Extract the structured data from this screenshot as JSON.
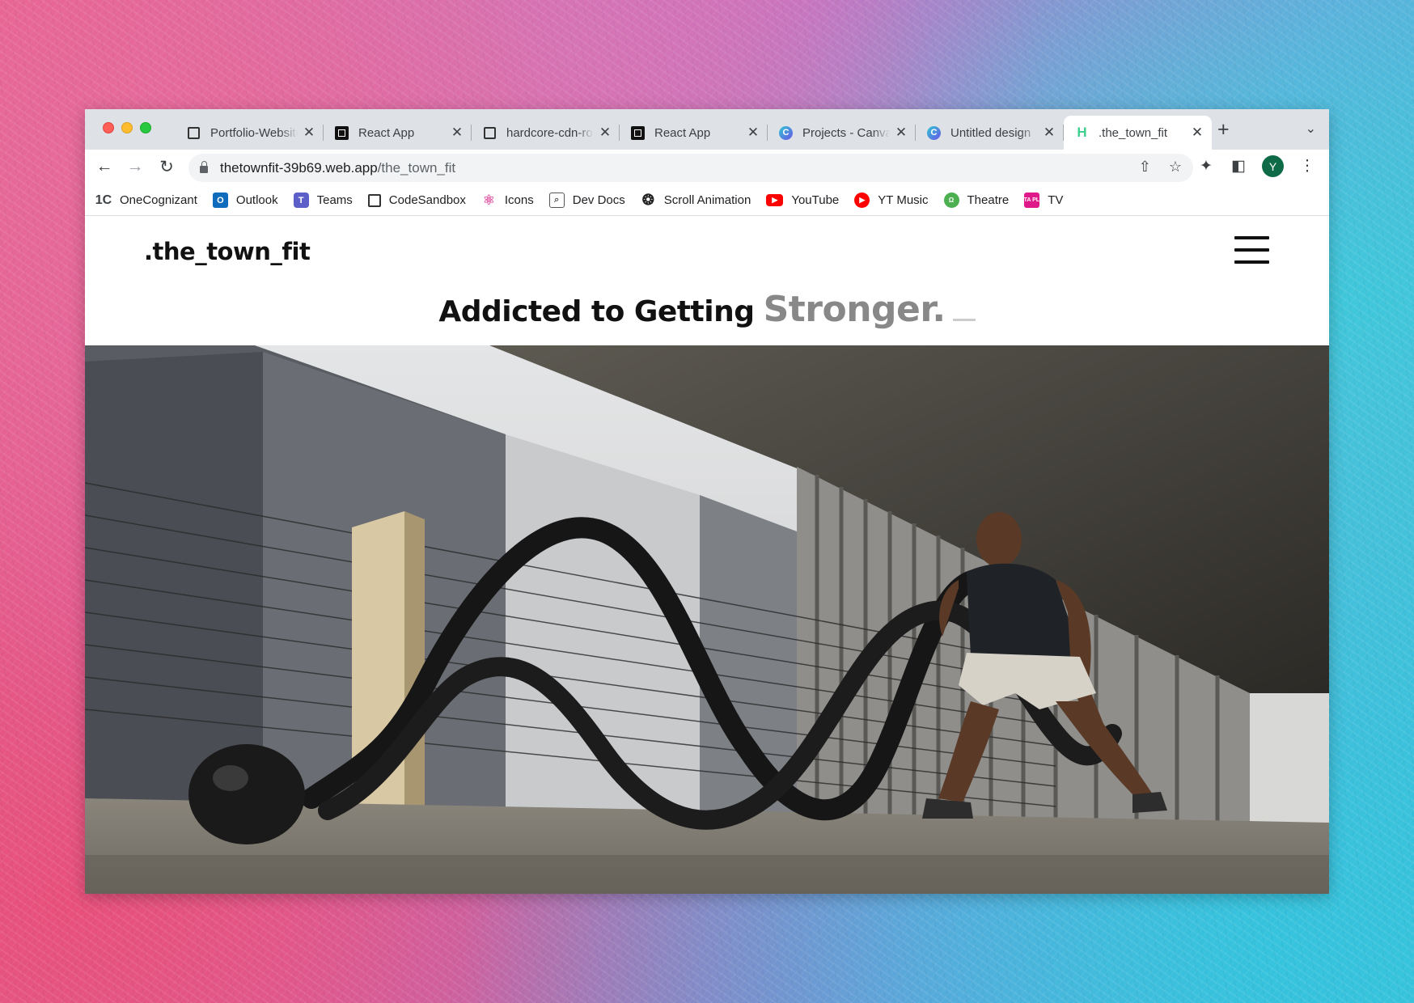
{
  "browser": {
    "tabs": [
      {
        "title": "Portfolio-Website",
        "favicon": "doc-icon",
        "active": false
      },
      {
        "title": "React App",
        "favicon": "react-app-icon",
        "active": false
      },
      {
        "title": "hardcore-cdn-rose",
        "favicon": "doc-icon",
        "active": false
      },
      {
        "title": "React App",
        "favicon": "react-app-icon",
        "active": false
      },
      {
        "title": "Projects - Canva",
        "favicon": "canva-icon",
        "active": false
      },
      {
        "title": "Untitled design",
        "favicon": "canva-icon",
        "active": false
      },
      {
        "title": ".the_town_fit",
        "favicon": "h-icon",
        "active": true
      }
    ],
    "close_glyph": "✕",
    "new_tab_glyph": "+",
    "url": {
      "host": "thetownfit-39b69.web.app",
      "path": "/the_town_fit"
    },
    "profile_initial": "Y",
    "bookmarks": [
      {
        "label": "OneCognizant",
        "icon": "onecognizant-icon",
        "glyph": "1C"
      },
      {
        "label": "Outlook",
        "icon": "outlook-icon",
        "glyph": "O"
      },
      {
        "label": "Teams",
        "icon": "teams-icon",
        "glyph": "T"
      },
      {
        "label": "CodeSandbox",
        "icon": "codesandbox-icon",
        "glyph": ""
      },
      {
        "label": "Icons",
        "icon": "atom-icon",
        "glyph": "⚛"
      },
      {
        "label": "Dev Docs",
        "icon": "devdocs-icon",
        "glyph": "⌕"
      },
      {
        "label": "Scroll Animation",
        "icon": "scroll-animation-icon",
        "glyph": "❂"
      },
      {
        "label": "YouTube",
        "icon": "youtube-icon",
        "glyph": "▶"
      },
      {
        "label": "YT Music",
        "icon": "yt-music-icon",
        "glyph": "▶"
      },
      {
        "label": "Theatre",
        "icon": "theatre-icon",
        "glyph": "Ω"
      },
      {
        "label": "TV",
        "icon": "tata-play-icon",
        "glyph": "TATA PLAY"
      }
    ]
  },
  "site": {
    "brand": ".the_town_fit",
    "headline_static": "Addicted to Getting",
    "headline_typed": "Stronger.",
    "hero_description": "hero-photo-battle-ropes"
  },
  "colors": {
    "accent_profile": "#0f6b47",
    "typed_text": "#888888"
  }
}
